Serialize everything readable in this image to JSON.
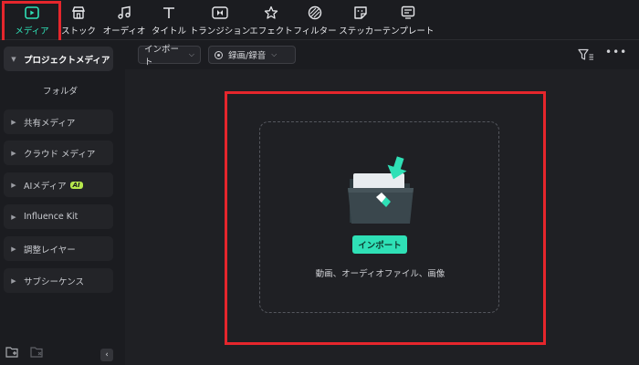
{
  "toolbar": {
    "items": [
      {
        "label": "メディア",
        "icon": "media-icon",
        "active": true
      },
      {
        "label": "ストック",
        "icon": "stock-icon"
      },
      {
        "label": "オーディオ",
        "icon": "music-note-icon"
      },
      {
        "label": "タイトル",
        "icon": "title-t-icon"
      },
      {
        "label": "トランジション",
        "icon": "transition-icon"
      },
      {
        "label": "エフェクト",
        "icon": "effect-star-icon"
      },
      {
        "label": "フィルター",
        "icon": "filter-icon"
      },
      {
        "label": "ステッカー",
        "icon": "sticker-icon"
      },
      {
        "label": "テンプレート",
        "icon": "template-icon"
      }
    ],
    "accent_color": "#2fe0b6"
  },
  "sidebar": {
    "items": [
      {
        "label": "プロジェクトメディア"
      },
      {
        "label": "フォルダ"
      },
      {
        "label": "共有メディア"
      },
      {
        "label": "クラウド メディア"
      },
      {
        "label": "AIメディア",
        "badge": "AI"
      },
      {
        "label": "Influence Kit"
      },
      {
        "label": "調整レイヤー"
      },
      {
        "label": "サブシーケンス"
      }
    ],
    "collapse_label": "‹"
  },
  "subbar": {
    "import_dropdown": "インポート",
    "record_dropdown": "録画/録音",
    "more_label": "•••"
  },
  "dropzone": {
    "import_button": "インポート",
    "hint": "動画、オーディオファイル、画像"
  },
  "highlight_color": "#e5262c"
}
